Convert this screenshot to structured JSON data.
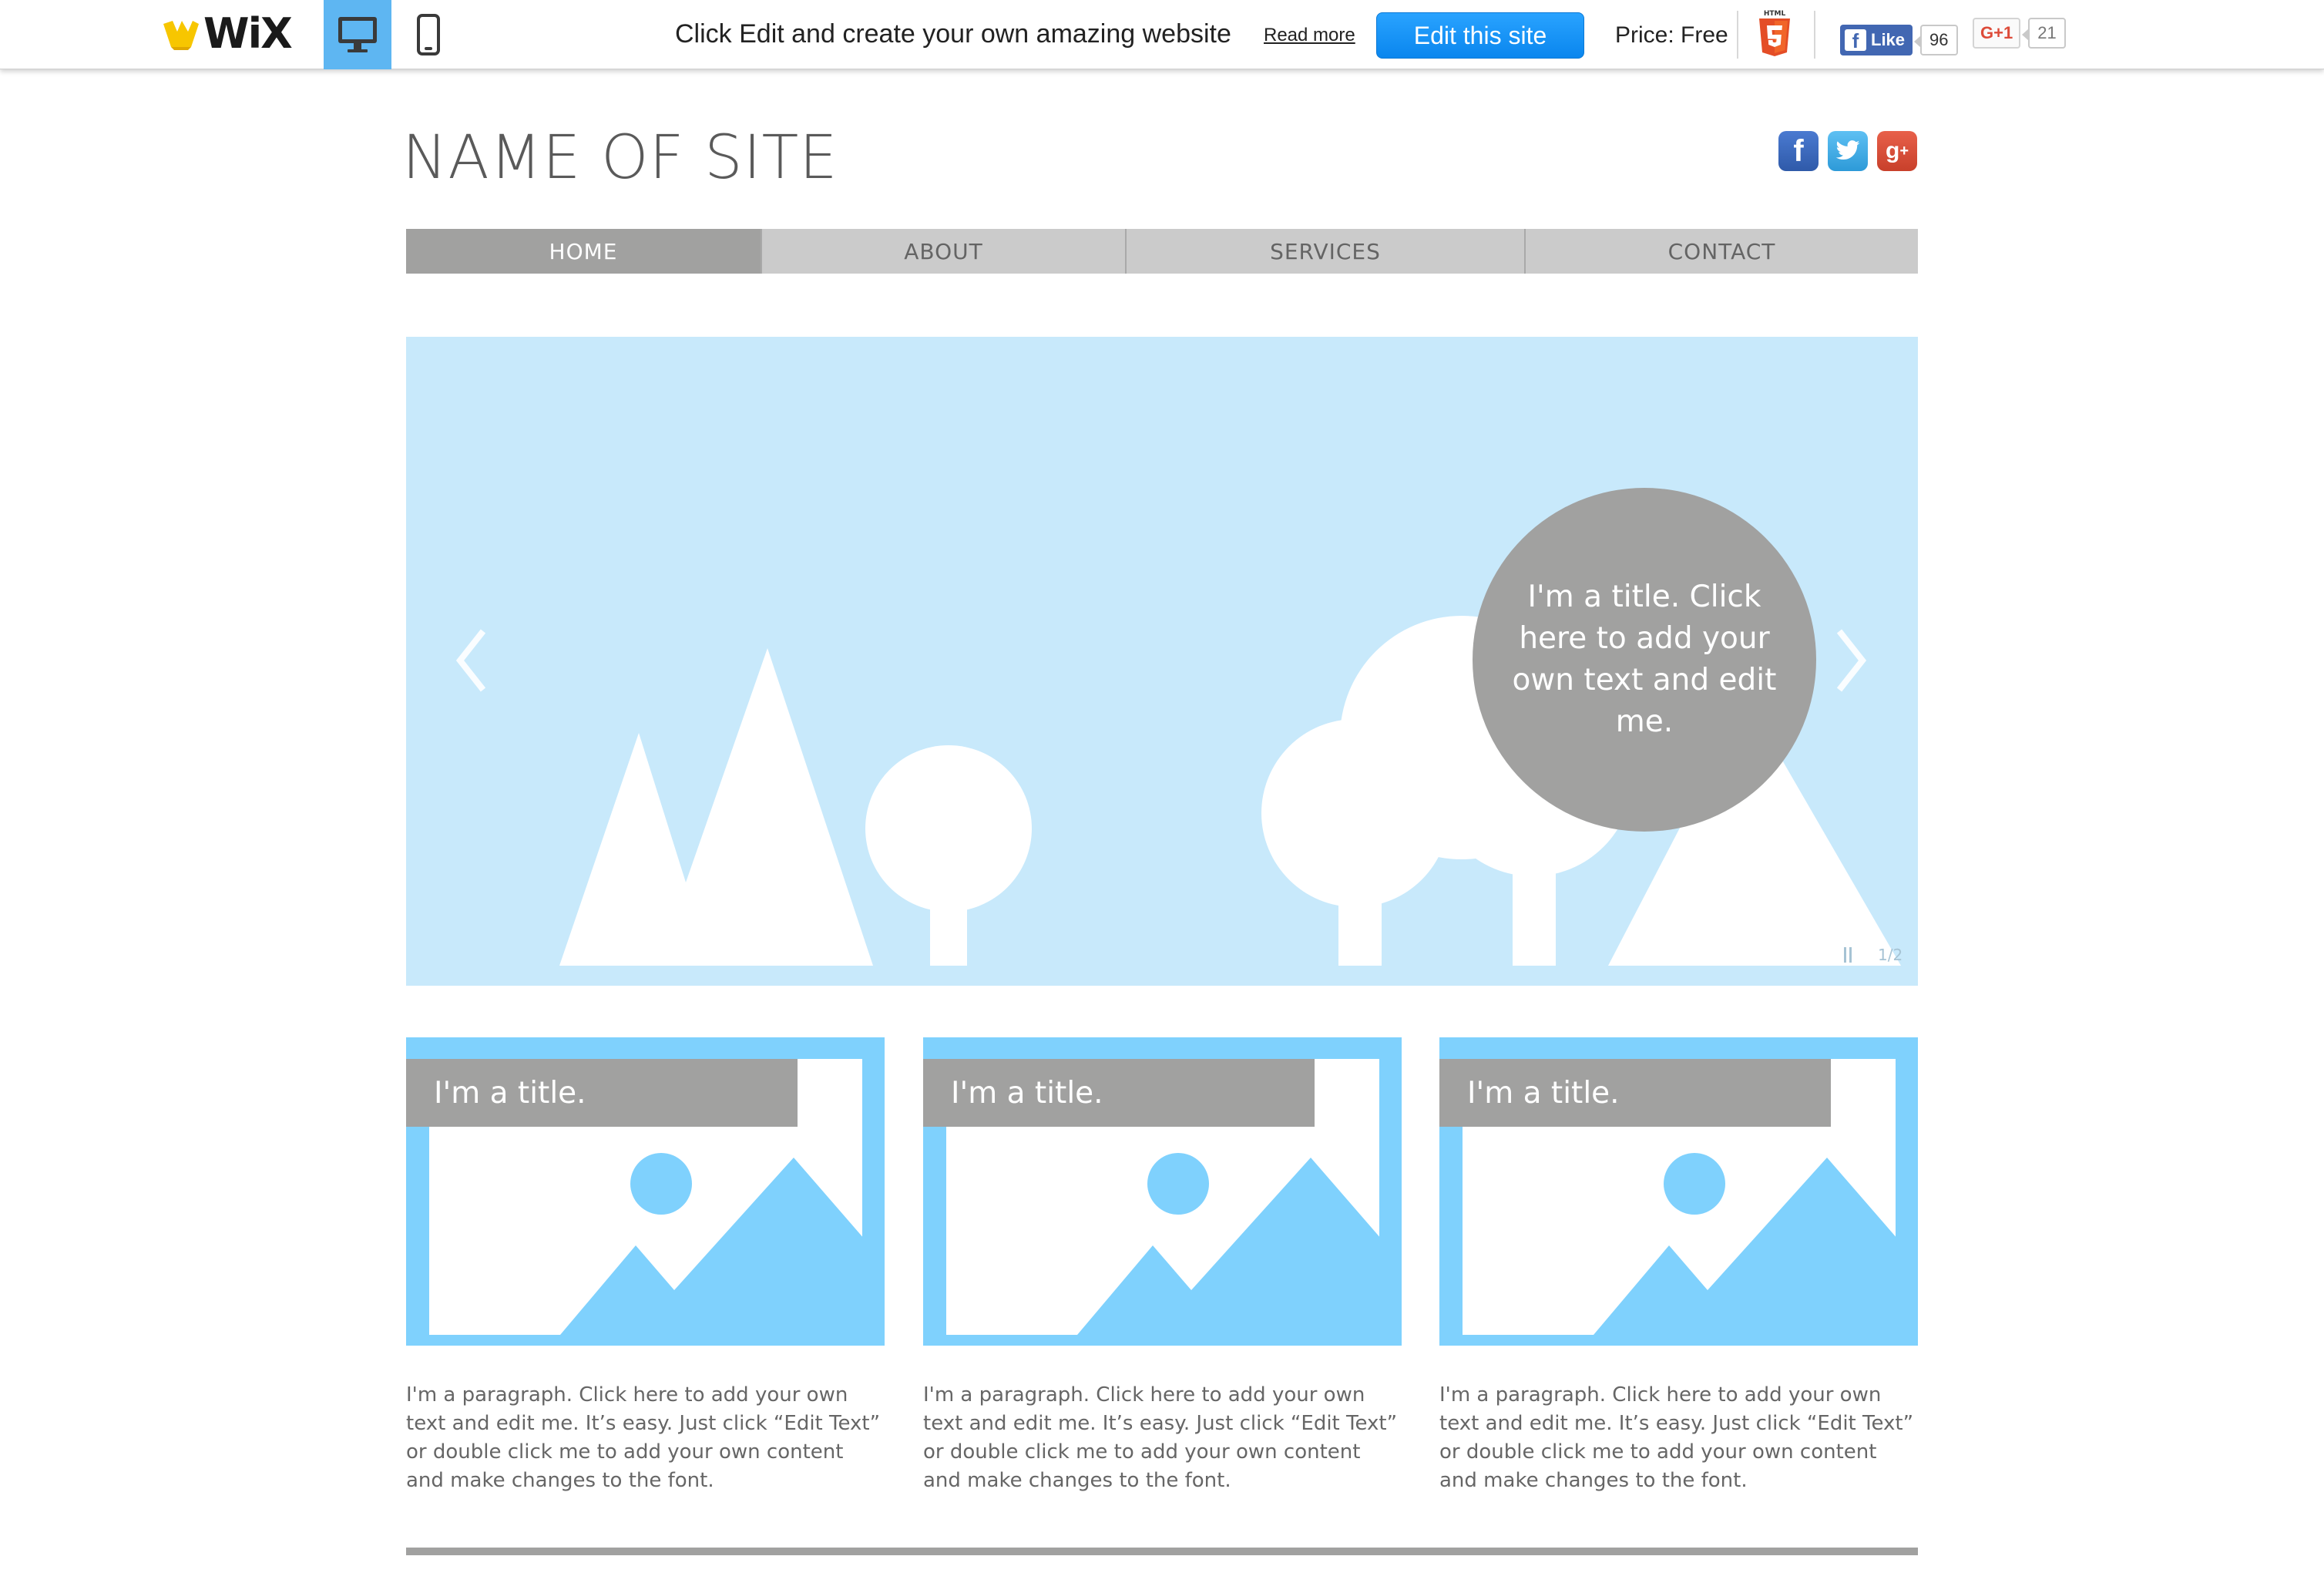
{
  "topbar": {
    "logo_text": "WiX",
    "promo_text": "Click Edit and create your own amazing website",
    "read_more": "Read more",
    "edit_button": "Edit this site",
    "price": "Price: Free",
    "html5_badge": "HTML",
    "fb_like_label": "Like",
    "fb_like_count": "96",
    "gplus_label": "G+1",
    "gplus_count": "21"
  },
  "site": {
    "name": "NAME OF SITE"
  },
  "nav": {
    "items": [
      {
        "label": "HOME",
        "active": true
      },
      {
        "label": "ABOUT",
        "active": false
      },
      {
        "label": "SERVICES",
        "active": false
      },
      {
        "label": "CONTACT",
        "active": false
      }
    ]
  },
  "hero": {
    "title": "I'm a title. Click here to add your own text and edit me.",
    "counter": "1/2"
  },
  "cards": [
    {
      "title": "I'm a title.",
      "text": "I'm a paragraph. Click here to add your own text and edit me. It’s easy. Just click “Edit Text” or double click me to add your own content and make changes to the font."
    },
    {
      "title": "I'm a title.",
      "text": "I'm a paragraph. Click here to add your own text and edit me. It’s easy. Just click “Edit Text” or double click me to add your own content and make changes to the font."
    },
    {
      "title": "I'm a title.",
      "text": "I'm a paragraph. Click here to add your own text and edit me. It’s easy. Just click “Edit Text” or double click me to add your own content and make changes to the font."
    }
  ],
  "colors": {
    "accent_blue": "#0a86ee",
    "hero_bg": "#c8e9fb",
    "card_blue": "#7fd1fd",
    "gray_block": "#a1a1a0",
    "nav_bg": "#cbcbcb"
  },
  "icons": [
    "wix-crown-icon",
    "desktop-icon",
    "mobile-icon",
    "html5-icon",
    "facebook-icon",
    "twitter-icon",
    "google-plus-icon",
    "chevron-left-icon",
    "chevron-right-icon",
    "pause-icon"
  ]
}
